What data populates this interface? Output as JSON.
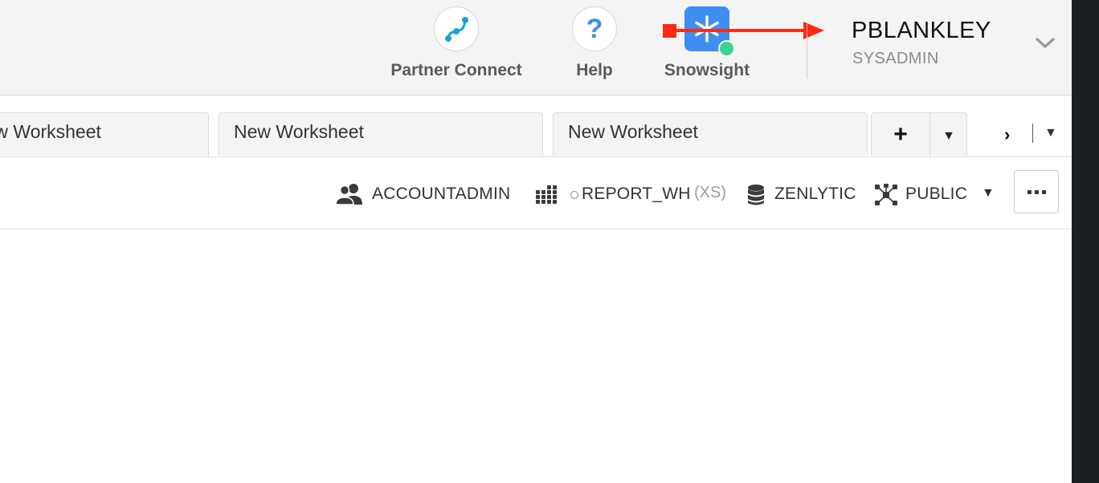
{
  "header": {
    "nav": {
      "partner_connect": "Partner Connect",
      "help": "Help",
      "snowsight": "Snowsight"
    },
    "user": {
      "name": "PBLANKLEY",
      "role": "SYSADMIN"
    }
  },
  "tabs": {
    "items": [
      {
        "label": "New Worksheet"
      },
      {
        "label": "New Worksheet"
      },
      {
        "label": "New Worksheet"
      }
    ],
    "add_label": "+"
  },
  "context": {
    "role": "ACCOUNTADMIN",
    "warehouse": "REPORT_WH",
    "warehouse_size": "(XS)",
    "database": "ZENLYTIC",
    "schema": "PUBLIC"
  },
  "colors": {
    "annotation_arrow": "#ff2a0f",
    "snowsight_tile": "#3d8ef0",
    "status_dot": "#3ad68e",
    "partner_connect_icon": "#1aa3d9",
    "help_icon": "#3d8ef0"
  },
  "icons": [
    "partner-connect-icon",
    "help-icon",
    "snowsight-icon",
    "chevron-down-icon",
    "role-icon",
    "warehouse-icon",
    "database-icon",
    "schema-icon",
    "more-icon"
  ]
}
